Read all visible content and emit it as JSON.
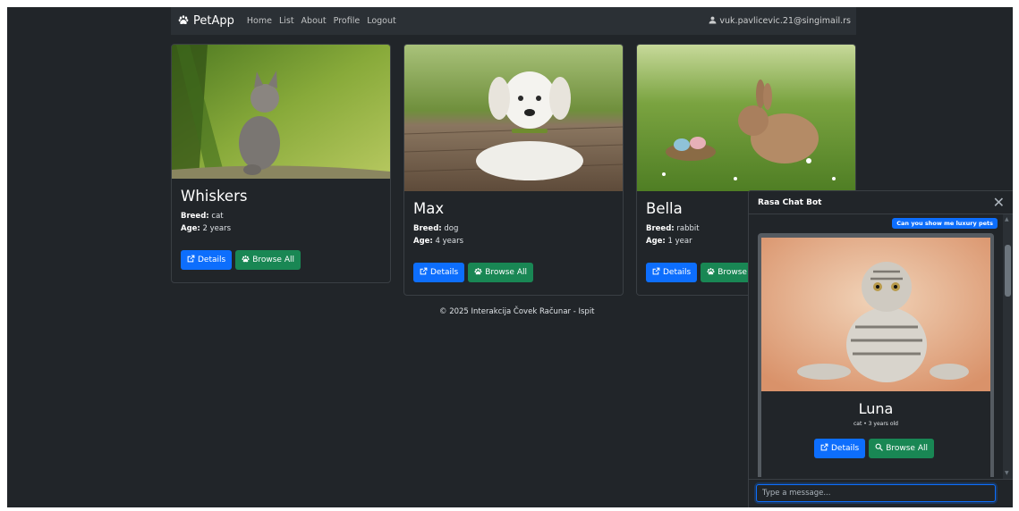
{
  "navbar": {
    "brand": "PetApp",
    "links": [
      "Home",
      "List",
      "About",
      "Profile",
      "Logout"
    ],
    "user_email": "vuk.pavlicevic.21@singimail.rs"
  },
  "cards": [
    {
      "name": "Whiskers",
      "breed_label": "Breed:",
      "breed": "cat",
      "age_label": "Age:",
      "age": "2 years",
      "details_label": "Details",
      "browse_label": "Browse All"
    },
    {
      "name": "Max",
      "breed_label": "Breed:",
      "breed": "dog",
      "age_label": "Age:",
      "age": "4 years",
      "details_label": "Details",
      "browse_label": "Browse All"
    },
    {
      "name": "Bella",
      "breed_label": "Breed:",
      "breed": "rabbit",
      "age_label": "Age:",
      "age": "1 year",
      "details_label": "Details",
      "browse_label": "Browse"
    }
  ],
  "footer": "© 2025 Interakcija Čovek Računar - Ispit",
  "chat": {
    "title": "Rasa Chat Bot",
    "user_message": "Can you show me luxury pets",
    "result": {
      "name": "Luna",
      "subtitle": "cat • 3 years old",
      "details_label": "Details",
      "browse_label": "Browse All"
    },
    "input_placeholder": "Type a message..."
  },
  "colors": {
    "background": "#212529",
    "navbar": "#2b3035",
    "primary": "#0d6efd",
    "success": "#198754"
  },
  "icons": [
    "paw-icon",
    "user-icon",
    "external-link-icon",
    "search-icon",
    "close-icon"
  ]
}
